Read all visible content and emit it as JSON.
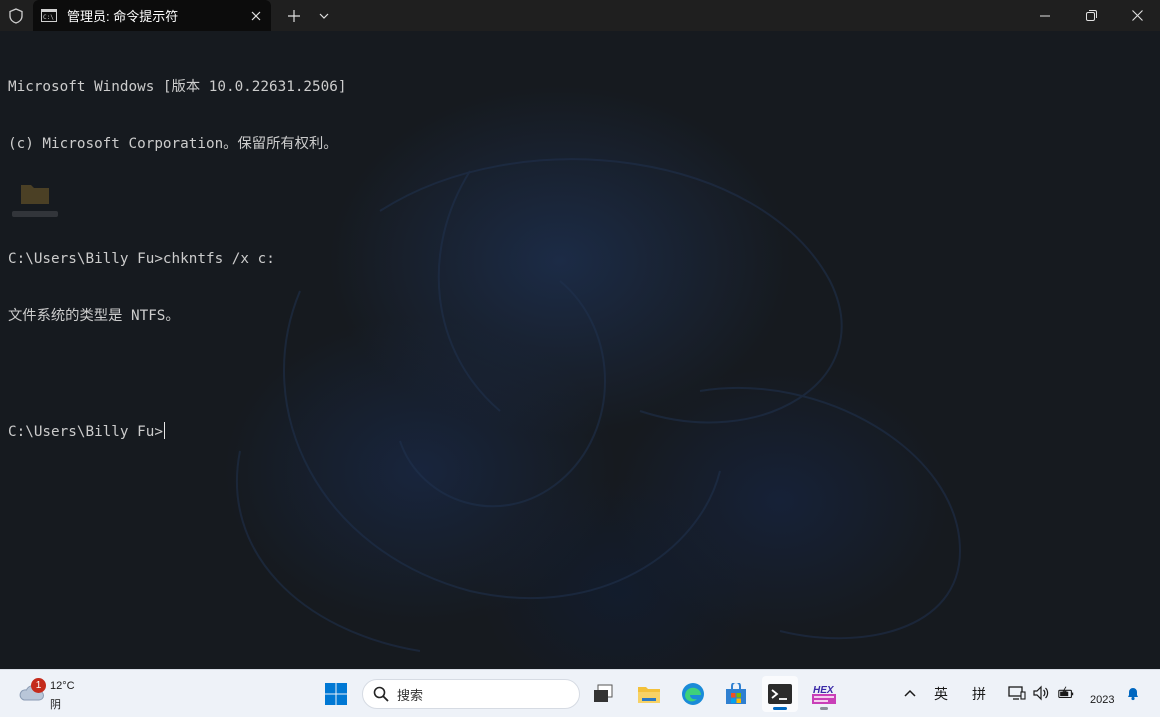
{
  "window": {
    "tab_title": "管理员: 命令提示符",
    "new_tab_symbol": "+",
    "dropdown_symbol": "⌄"
  },
  "console": {
    "lines": [
      "Microsoft Windows [版本 10.0.22631.2506]",
      "(c) Microsoft Corporation。保留所有权利。",
      "",
      "C:\\Users\\Billy Fu>chkntfs /x c:",
      "文件系统的类型是 NTFS。",
      "",
      "C:\\Users\\Billy Fu>"
    ]
  },
  "taskbar": {
    "weather": {
      "badge": "1",
      "temperature": "12°C",
      "condition": "阴"
    },
    "search_label": "搜索",
    "hex_label": "HEX",
    "tray": {
      "ime_lang": "英",
      "ime_mode": "拼"
    },
    "clock_year": "2023"
  },
  "colors": {
    "accent": "#0067c0",
    "terminal_text": "#cccccc",
    "badge": "#c42b1c"
  }
}
